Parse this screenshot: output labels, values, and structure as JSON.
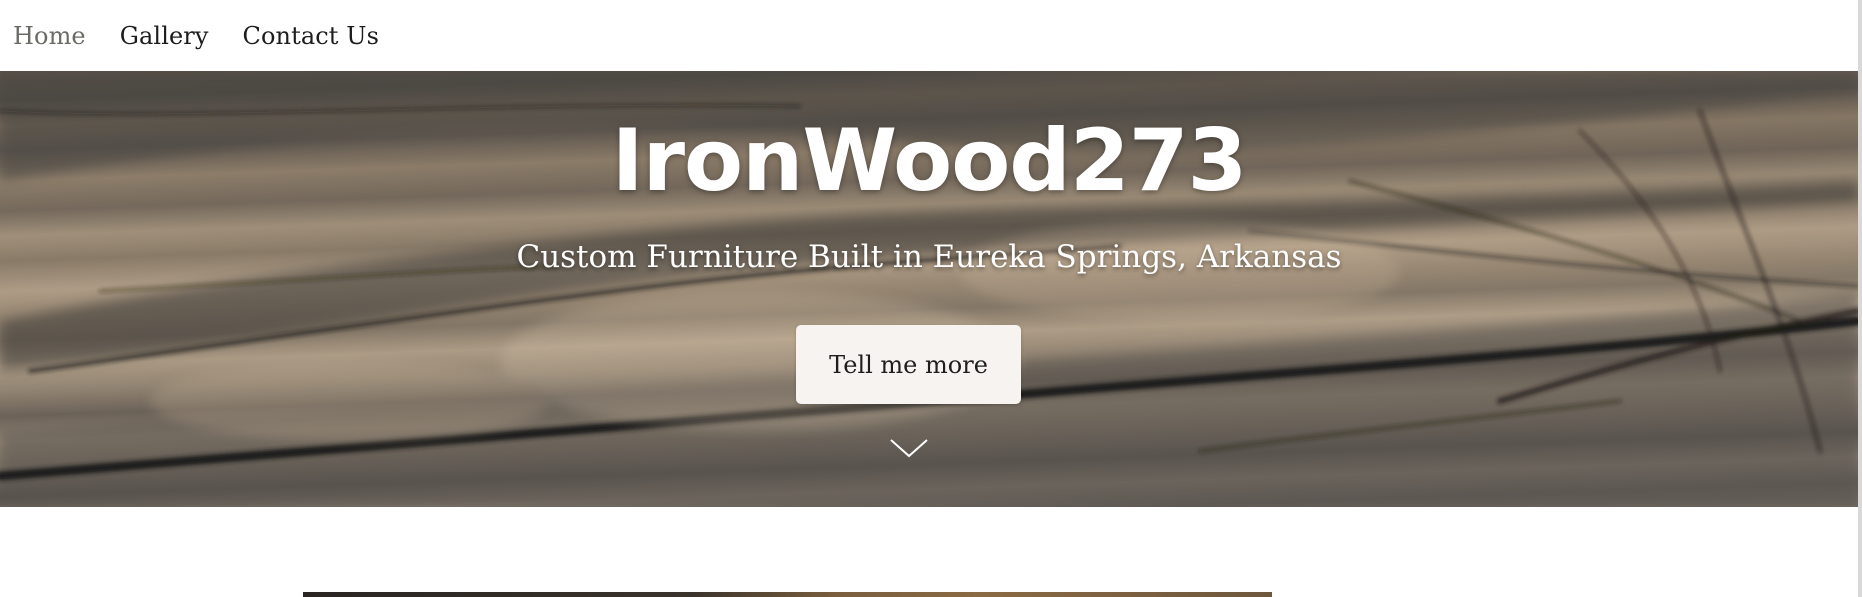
{
  "nav": {
    "items": [
      {
        "label": "Home",
        "active": true
      },
      {
        "label": "Gallery",
        "active": false
      },
      {
        "label": "Contact Us",
        "active": false
      }
    ]
  },
  "hero": {
    "title": "IronWood273",
    "subtitle": "Custom Furniture Built in Eureka Springs, Arkansas",
    "button_label": "Tell me more",
    "scroll_icon": "chevron-down-icon"
  },
  "colors": {
    "nav_text": "#1c1c1c",
    "nav_active": "#6b6b66",
    "hero_text": "#ffffff",
    "button_bg": "#f7f3f0"
  }
}
